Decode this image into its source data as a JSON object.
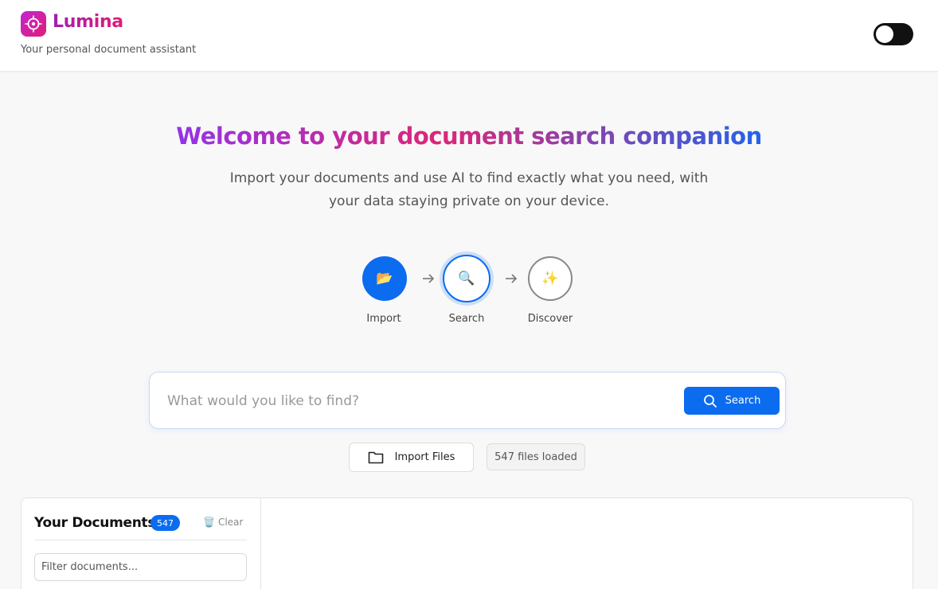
{
  "app": {
    "name": "Lumina",
    "tagline": "Your personal document assistant"
  },
  "hero": {
    "title": "Welcome to your document search companion",
    "subtitle": "Import your documents and use AI to find exactly what you need, with your data staying private on your device."
  },
  "steps": [
    {
      "label": "Import",
      "icon": "folder-open-icon",
      "glyph": "📂"
    },
    {
      "label": "Search",
      "icon": "magnifier-icon",
      "glyph": "🔍"
    },
    {
      "label": "Discover",
      "icon": "sparkles-icon",
      "glyph": "✨"
    }
  ],
  "search": {
    "placeholder": "What would you like to find?",
    "value": "",
    "button_label": "Search"
  },
  "import": {
    "button_label": "Import Files",
    "files_loaded": "547 files loaded"
  },
  "documents": {
    "title": "Your Documents",
    "count": "547",
    "clear_label": "Clear",
    "clear_glyph": "🗑️",
    "filter_placeholder": "Filter documents..."
  },
  "colors": {
    "accent": "#0b6cf0",
    "brand_start": "#c026d3",
    "brand_end": "#e11d74"
  }
}
